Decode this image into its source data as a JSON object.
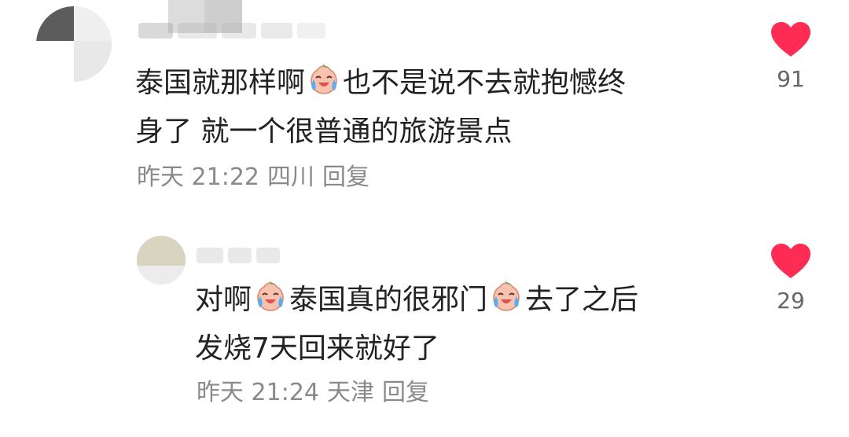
{
  "comments": [
    {
      "text_line1": "泰国就那样啊",
      "text_line1b": "也不是说不去就抱憾终",
      "text_line2": "身了 就一个很普通的旅游景点",
      "time": "昨天 21:22",
      "location": "四川",
      "reply_label": "回复",
      "likes": "91",
      "emoji_icon": "crying-face-icon"
    },
    {
      "text_a": "对啊",
      "text_b": "泰国真的很邪门",
      "text_c": "去了之后",
      "text_line2": "发烧7天回来就好了",
      "time": "昨天 21:24",
      "location": "天津",
      "reply_label": "回复",
      "likes": "29",
      "emoji_icon": "crying-face-icon"
    }
  ],
  "colors": {
    "text": "#222222",
    "meta": "#8a8a8a",
    "heart": "#fe2c55",
    "count": "#666666"
  }
}
